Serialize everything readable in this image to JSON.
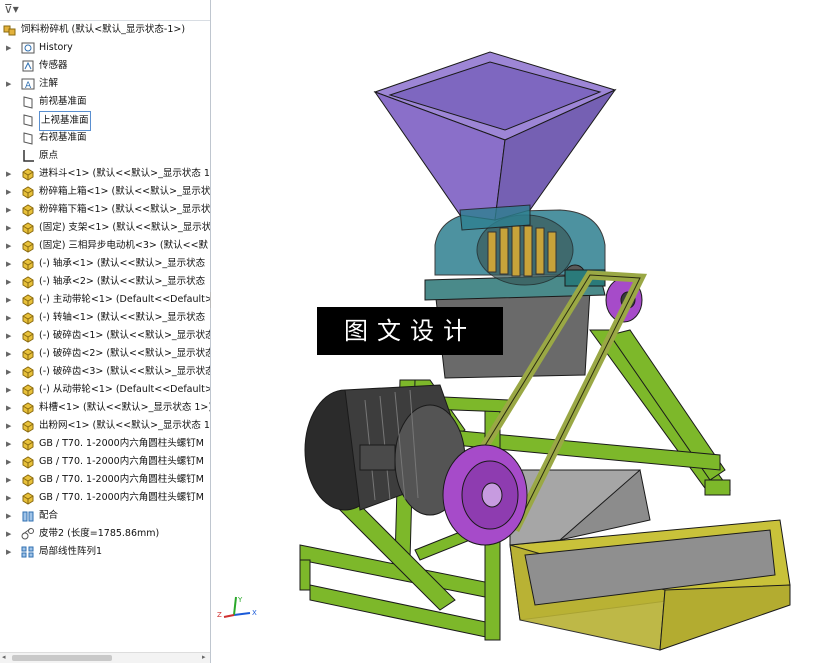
{
  "tree": {
    "root_label": "饲料粉碎机 (默认<默认_显示状态-1>)",
    "items": [
      {
        "label": "History",
        "icon": "history-icon",
        "expandable": true
      },
      {
        "label": "传感器",
        "icon": "sensor-icon",
        "expandable": false
      },
      {
        "label": "注解",
        "icon": "annotation-icon",
        "expandable": true
      },
      {
        "label": "前视基准面",
        "icon": "plane-icon",
        "expandable": false
      },
      {
        "label": "上视基准面",
        "icon": "plane-icon",
        "expandable": false,
        "selected": true
      },
      {
        "label": "右视基准面",
        "icon": "plane-icon",
        "expandable": false
      },
      {
        "label": "原点",
        "icon": "origin-icon",
        "expandable": false
      },
      {
        "label": "进料斗<1> (默认<<默认>_显示状态 1",
        "icon": "part-icon",
        "expandable": true
      },
      {
        "label": "粉碎箱上箱<1> (默认<<默认>_显示状",
        "icon": "part-icon",
        "expandable": true
      },
      {
        "label": "粉碎箱下箱<1> (默认<<默认>_显示状",
        "icon": "part-icon",
        "expandable": true
      },
      {
        "label": "(固定) 支架<1> (默认<<默认>_显示状",
        "icon": "part-icon",
        "expandable": true
      },
      {
        "label": "(固定) 三相异步电动机<3> (默认<<默",
        "icon": "part-icon",
        "expandable": true
      },
      {
        "label": "(-) 轴承<1> (默认<<默认>_显示状态 ",
        "icon": "part-icon",
        "expandable": true
      },
      {
        "label": "(-) 轴承<2> (默认<<默认>_显示状态 ",
        "icon": "part-icon",
        "expandable": true
      },
      {
        "label": "(-) 主动带轮<1> (Default<<Default>_",
        "icon": "part-icon",
        "expandable": true
      },
      {
        "label": "(-) 转轴<1> (默认<<默认>_显示状态 ",
        "icon": "part-icon",
        "expandable": true
      },
      {
        "label": "(-) 破碎齿<1> (默认<<默认>_显示状态",
        "icon": "part-icon",
        "expandable": true
      },
      {
        "label": "(-) 破碎齿<2> (默认<<默认>_显示状态",
        "icon": "part-icon",
        "expandable": true
      },
      {
        "label": "(-) 破碎齿<3> (默认<<默认>_显示状态",
        "icon": "part-icon",
        "expandable": true
      },
      {
        "label": "(-) 从动带轮<1> (Default<<Default>_",
        "icon": "part-icon",
        "expandable": true
      },
      {
        "label": "料槽<1> (默认<<默认>_显示状态 1>)",
        "icon": "part-icon",
        "expandable": true
      },
      {
        "label": "出粉网<1> (默认<<默认>_显示状态 1",
        "icon": "part-icon",
        "expandable": true
      },
      {
        "label": "GB / T70. 1-2000内六角圆柱头螺钉M",
        "icon": "part-icon",
        "expandable": true
      },
      {
        "label": "GB / T70. 1-2000内六角圆柱头螺钉M",
        "icon": "part-icon",
        "expandable": true
      },
      {
        "label": "GB / T70. 1-2000内六角圆柱头螺钉M",
        "icon": "part-icon",
        "expandable": true
      },
      {
        "label": "GB / T70. 1-2000内六角圆柱头螺钉M",
        "icon": "part-icon",
        "expandable": true
      },
      {
        "label": "配合",
        "icon": "mates-icon",
        "expandable": true
      },
      {
        "label": "皮带2 (长度=1785.86mm)",
        "icon": "belt-icon",
        "expandable": true
      },
      {
        "label": "局部线性阵列1",
        "icon": "pattern-icon",
        "expandable": true
      }
    ]
  },
  "watermark": "图文设计",
  "triad": {
    "x": "X",
    "y": "Y",
    "z": "Z"
  },
  "colors": {
    "hopper": "#8a6fc9",
    "frame": "#7db82a",
    "tray": "#c9c23a",
    "motor": "#3d3d3d",
    "pulley": "#a64bc9",
    "belt": "#9aa845",
    "housing": "#2e8090",
    "tree_selection": "#5a8fd0"
  }
}
